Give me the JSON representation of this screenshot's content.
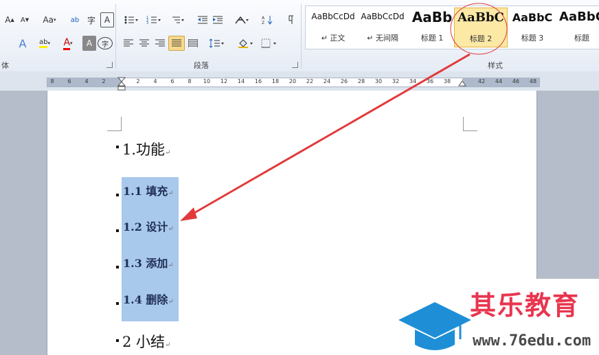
{
  "ribbon": {
    "groups": {
      "font_label": "体",
      "paragraph_label": "段落",
      "styles_label": "样式"
    },
    "font_buttons": [
      "A",
      "A",
      "Aa",
      "ab",
      "A",
      "A",
      "A",
      "字"
    ],
    "styles": [
      {
        "sample": "AaBbCcDd",
        "name": "↵ 正文"
      },
      {
        "sample": "AaBbCcDd",
        "name": "↵ 无间隔"
      },
      {
        "sample": "AaBb",
        "name": "标题 1"
      },
      {
        "sample": "AaBbC",
        "name": "标题 2"
      },
      {
        "sample": "AaBbC",
        "name": "标题 3"
      },
      {
        "sample": "AaBbC",
        "name": "标题"
      }
    ]
  },
  "ruler": {
    "ticks": [
      "8",
      "6",
      "4",
      "2",
      "2",
      "4",
      "6",
      "8",
      "10",
      "12",
      "14",
      "16",
      "18",
      "20",
      "22",
      "24",
      "26",
      "28",
      "30",
      "32",
      "34",
      "36",
      "38",
      "42",
      "44",
      "46",
      "48"
    ]
  },
  "document": {
    "h1": "1.功能",
    "items": [
      "1.1 填充",
      "1.2 设计",
      "1.3 添加",
      "1.4 删除"
    ],
    "h1b": "2 小结",
    "para_mark": "↵"
  },
  "watermark": {
    "title": "其乐教育",
    "url": "www.76edu.com"
  },
  "colors": {
    "arrow": "#e23a3a",
    "selection": "#a8c8ec",
    "accent": "#e8364f",
    "logo_blue": "#1e8fd6"
  }
}
